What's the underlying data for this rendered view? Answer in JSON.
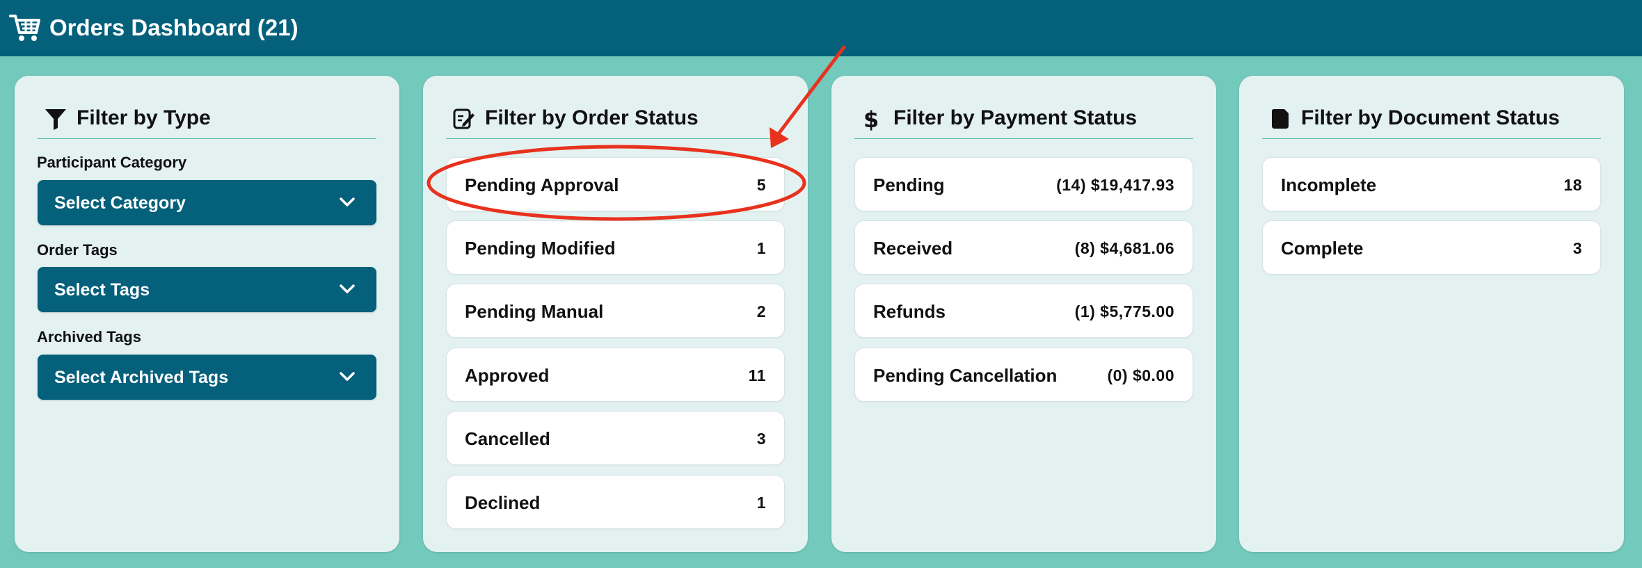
{
  "header": {
    "title": "Orders Dashboard (21)",
    "icon": "shopping-cart-icon",
    "background": "#04607b"
  },
  "page_background": "#72c9bc",
  "panels": {
    "type": {
      "title": "Filter by Type",
      "icon": "funnel-icon",
      "fields": [
        {
          "label": "Participant Category",
          "value": "Select Category"
        },
        {
          "label": "Order Tags",
          "value": "Select Tags"
        },
        {
          "label": "Archived Tags",
          "value": "Select Archived Tags"
        }
      ]
    },
    "order_status": {
      "title": "Filter by Order Status",
      "icon": "edit-note-icon",
      "items": [
        {
          "label": "Pending Approval",
          "count": "5"
        },
        {
          "label": "Pending Modified",
          "count": "1"
        },
        {
          "label": "Pending Manual",
          "count": "2"
        },
        {
          "label": "Approved",
          "count": "11"
        },
        {
          "label": "Cancelled",
          "count": "3"
        },
        {
          "label": "Declined",
          "count": "1"
        }
      ]
    },
    "payment_status": {
      "title": "Filter by Payment Status",
      "icon": "dollar-icon",
      "items": [
        {
          "label": "Pending",
          "value": "(14) $19,417.93"
        },
        {
          "label": "Received",
          "value": "(8) $4,681.06"
        },
        {
          "label": "Refunds",
          "value": "(1) $5,775.00"
        },
        {
          "label": "Pending Cancellation",
          "value": "(0) $0.00"
        }
      ]
    },
    "document_status": {
      "title": "Filter by Document Status",
      "icon": "file-icon",
      "items": [
        {
          "label": "Incomplete",
          "count": "18"
        },
        {
          "label": "Complete",
          "count": "3"
        }
      ]
    }
  },
  "annotation": {
    "color": "#e8321e",
    "target": "Pending Approval"
  }
}
